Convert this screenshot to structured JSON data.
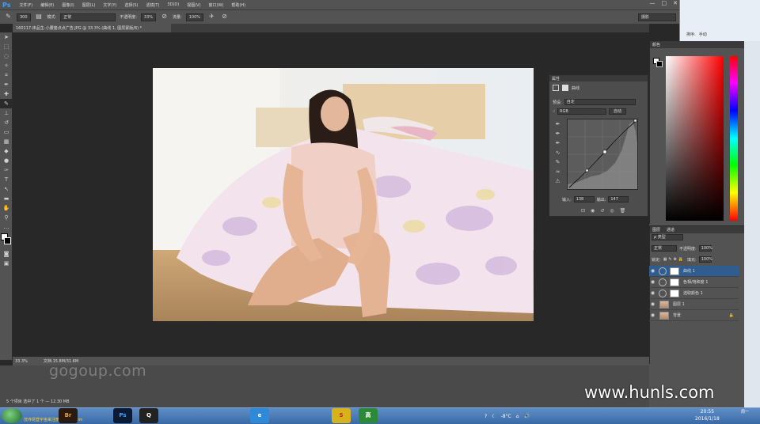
{
  "app": {
    "logo": "Ps"
  },
  "menu": [
    "文件(F)",
    "编辑(E)",
    "图像(I)",
    "图层(L)",
    "文字(Y)",
    "选择(S)",
    "滤镜(T)",
    "3D(D)",
    "视图(V)",
    "窗口(W)",
    "帮助(H)"
  ],
  "window_controls": [
    "—",
    "□",
    "✕"
  ],
  "options": {
    "brush_size": "300",
    "mode_label": "模式:",
    "mode_value": "正常",
    "opacity_label": "不透明度:",
    "opacity_value": "33%",
    "flow_label": "流量:",
    "flow_value": "100%",
    "workspace": "摄影"
  },
  "document_tab": "160117-床品生-小腰套点点广告.JPG @ 33.3% (曲线 1, 图层蒙版/8) *",
  "status": {
    "zoom": "33.3%",
    "doc_size": "文档:15.8M/31.6M"
  },
  "explorer_status": "5 个项目   选中了 1 个 — 12.30 MB",
  "watermarks": {
    "left": "gogoup.com",
    "right": "www.hunls.com"
  },
  "properties": {
    "tab": "属性",
    "title": "曲线",
    "preset_label": "预设:",
    "preset_value": "自定",
    "channel_value": "RGB",
    "auto_button": "自动",
    "input_label": "输入:",
    "input_value": "138",
    "output_label": "输出:",
    "output_value": "147"
  },
  "color_panel": {
    "tabs": [
      "颜色"
    ]
  },
  "layers_panel": {
    "tabs": [
      "图层",
      "通道"
    ],
    "kind_filter": "ρ 类型",
    "blend_mode": "正常",
    "opacity_label": "不透明度:",
    "opacity_value": "100%",
    "lock_label": "锁定:",
    "fill_label": "填充:",
    "fill_value": "100%",
    "layers": [
      {
        "name": "曲线 1",
        "type": "adjustment",
        "selected": true
      },
      {
        "name": "色相/饱和度 1",
        "type": "adjustment",
        "selected": false
      },
      {
        "name": "选取颜色 1",
        "type": "adjustment",
        "selected": false
      },
      {
        "name": "图层 1",
        "type": "image",
        "selected": false
      },
      {
        "name": "背景",
        "type": "image",
        "selected": false
      }
    ]
  },
  "outer_window": {
    "sort_label": "排序:",
    "sort_value": "手动"
  },
  "taskbar": {
    "start_label": "茂寺昆登宇宙来注册 tlxsoft.com",
    "apps": [
      "Br",
      "Ps",
      "Q",
      "e",
      "S",
      "高"
    ],
    "weather": "-8°C",
    "clock_time": "20:55",
    "clock_date": "2016/1/18",
    "day": "周一"
  },
  "colors": {
    "accent_select": "#2f5d8f",
    "ps_blue": "#3ea0ff",
    "taskbar": "#3a6aa6"
  }
}
